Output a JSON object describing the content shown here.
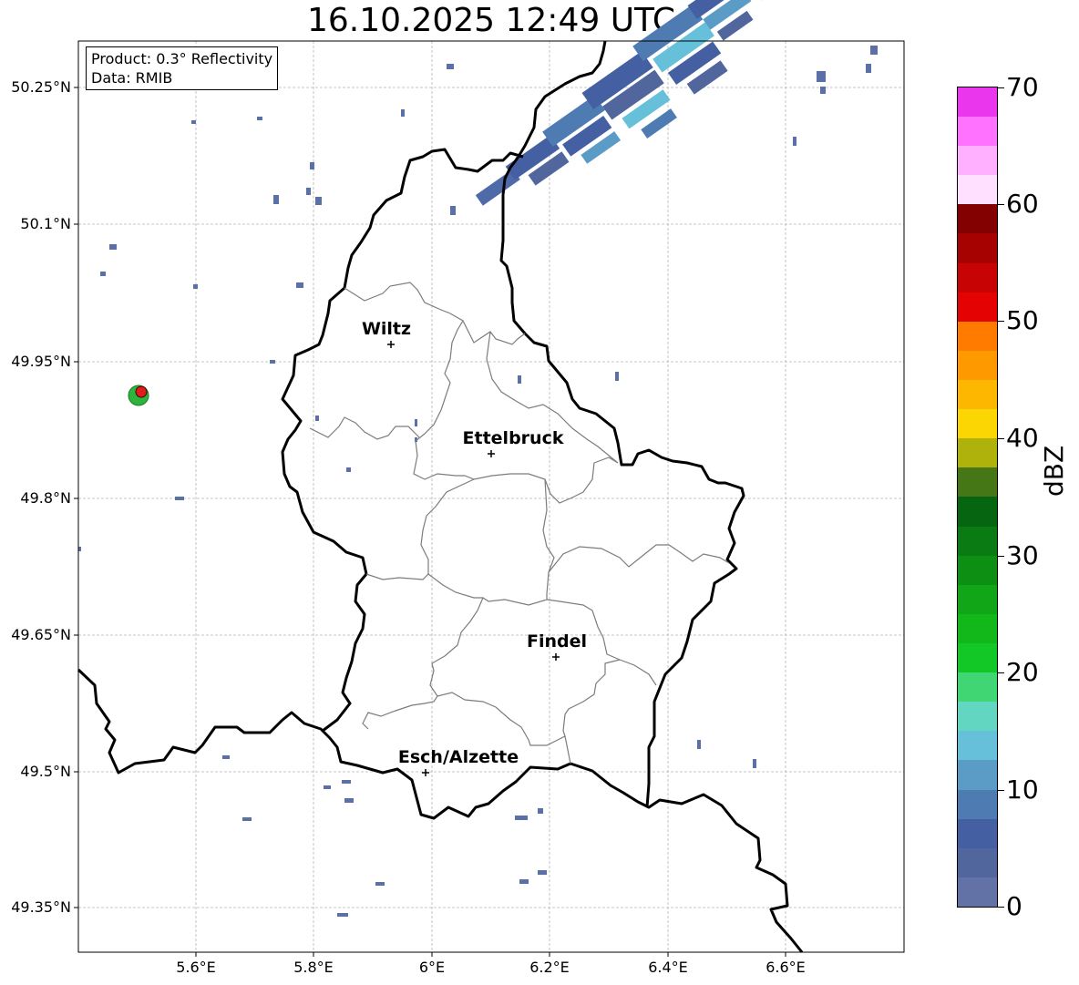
{
  "title": "16.10.2025 12:49 UTC",
  "info": {
    "product": "Product: 0.3° Reflectivity",
    "data": "Data: RMIB"
  },
  "axes": {
    "lat_ticks": [
      "50.25°N",
      "50.1°N",
      "49.95°N",
      "49.8°N",
      "49.65°N",
      "49.5°N",
      "49.35°N"
    ],
    "lon_ticks": [
      "5.6°E",
      "5.8°E",
      "6°E",
      "6.2°E",
      "6.4°E",
      "6.6°E"
    ]
  },
  "cities": [
    {
      "name": "Wiltz"
    },
    {
      "name": "Ettelbruck"
    },
    {
      "name": "Findel"
    },
    {
      "name": "Esch/Alzette"
    }
  ],
  "colorbar": {
    "label": "dBZ",
    "ticks": [
      "0",
      "10",
      "20",
      "30",
      "40",
      "50",
      "60",
      "70"
    ],
    "colors": [
      "#6272a6",
      "#52669e",
      "#4460a2",
      "#4f7bb3",
      "#5b9cc6",
      "#66c0da",
      "#62d6c0",
      "#3fd673",
      "#12c826",
      "#12b81a",
      "#11a518",
      "#0d8f14",
      "#0a7a12",
      "#066510",
      "#457716",
      "#aeb20a",
      "#fcd602",
      "#fdb700",
      "#fe9a00",
      "#ff7b00",
      "#e50202",
      "#c80303",
      "#a60202",
      "#840101",
      "#ffe1ff",
      "#ffb1ff",
      "#ff72ff",
      "#ea37ee"
    ]
  }
}
